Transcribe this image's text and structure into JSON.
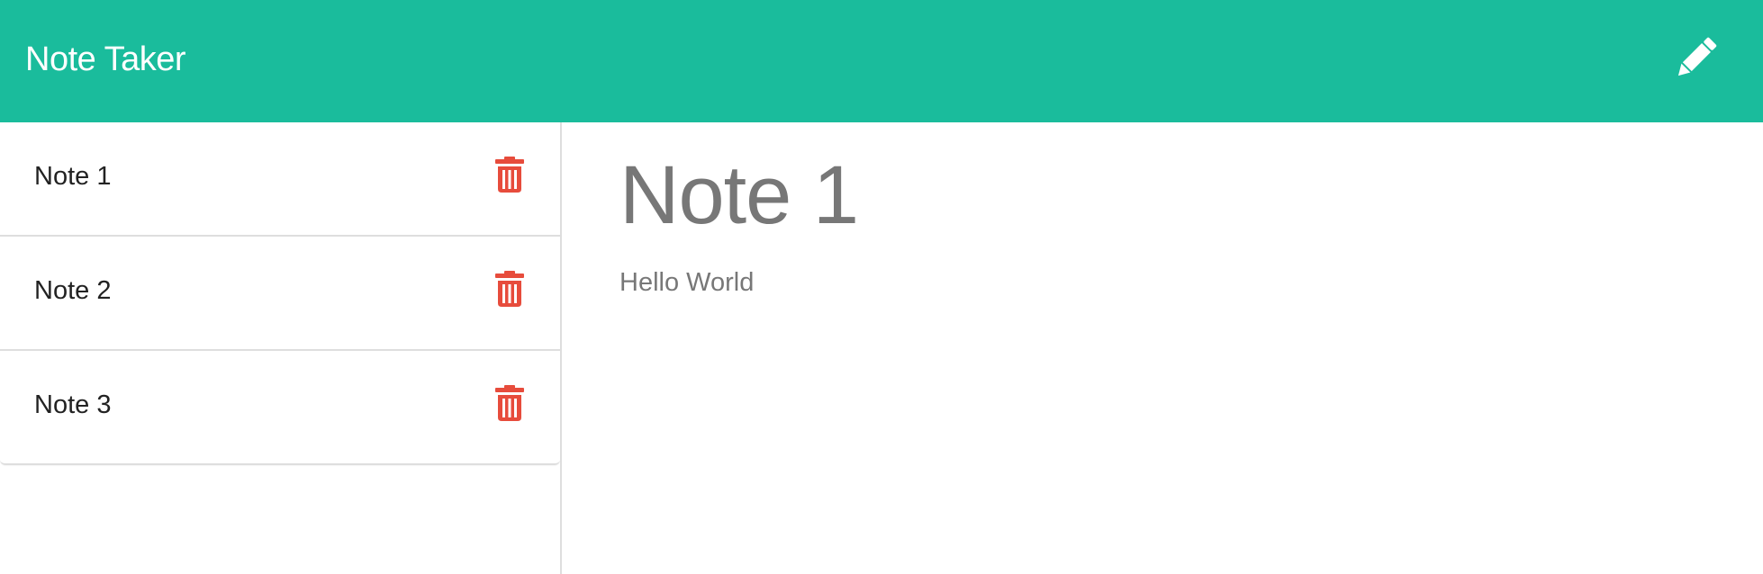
{
  "app": {
    "title": "Note Taker"
  },
  "icons": {
    "new_note": "pencil-icon",
    "delete": "trash-icon"
  },
  "colors": {
    "navbar": "#1abc9c",
    "delete": "#e74c3c",
    "text_muted": "#777777"
  },
  "notes": [
    {
      "title": "Note 1"
    },
    {
      "title": "Note 2"
    },
    {
      "title": "Note 3"
    }
  ],
  "active_note": {
    "title": "Note 1",
    "text": "Hello World"
  }
}
